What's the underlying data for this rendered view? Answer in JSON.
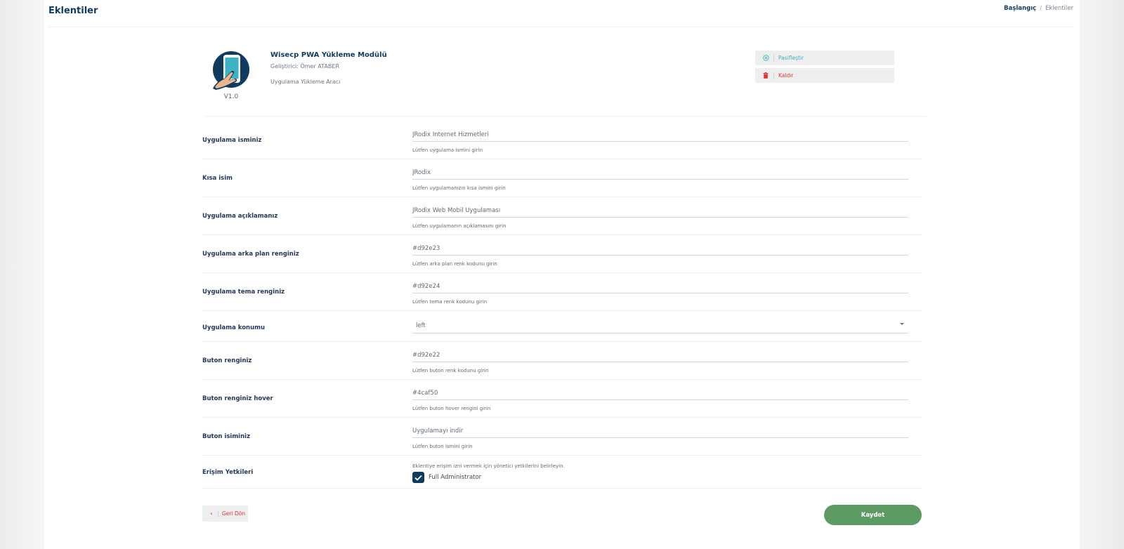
{
  "page": {
    "title": "Eklentiler"
  },
  "breadcrumb": {
    "home": "Başlangıç",
    "separator": "/",
    "current": "Eklentiler"
  },
  "plugin": {
    "name": "Wisecp PWA Yükleme Modülü",
    "developer": "Geliştirici: Ömer ATABER",
    "description": "Uygulama Yükleme Aracı",
    "version": "V1.0",
    "logo_icon": "phone-touch-icon"
  },
  "actions": {
    "deactivate": {
      "label": "Pasifleştir",
      "icon": "circle-x-icon",
      "color": "#3bb3c3"
    },
    "remove": {
      "label": "Kaldır",
      "icon": "trash-icon",
      "color": "#e0352f"
    }
  },
  "form": {
    "app_name": {
      "label": "Uygulama isminiz",
      "value": "JRodix Internet Hizmetleri",
      "help": "Lütfen uygulama ismini girin"
    },
    "short_name": {
      "label": "Kısa isim",
      "value": "JRodix",
      "help": "Lütfen uygulamanızın kısa ismini girin"
    },
    "app_description": {
      "label": "Uygulama açıklamanız",
      "value": "JRodix Web Mobil Uygulaması",
      "help": "Lütfen uygulamanın açıklamasını girin"
    },
    "bg_color": {
      "label": "Uygulama arka plan renginiz",
      "value": "#d92e23",
      "help": "Lütfen arka plan renk kodunu girin"
    },
    "theme_color": {
      "label": "Uygulama tema renginiz",
      "value": "#d92e24",
      "help": "Lütfen tema renk kodunu girin"
    },
    "position": {
      "label": "Uygulama konumu",
      "selected": "left"
    },
    "button_color": {
      "label": "Buton renginiz",
      "value": "#d92e22",
      "help": "Lütfen buton renk kodunu girin"
    },
    "button_hover": {
      "label": "Buton renginiz hover",
      "value": "#4caf50",
      "help": "Lütfen buton hover rengini girin"
    },
    "button_name": {
      "label": "Buton isiminiz",
      "value": "Uygulamayı indir",
      "help": "Lütfen buton ismini girin"
    },
    "permissions": {
      "label": "Erişim Yetkileri",
      "help": "Eklentiye erişim izni vermek için yönetici yetkilerini belirleyin.",
      "option": "Full Administrator",
      "checked": true
    }
  },
  "footer": {
    "back_label": "Geri Dön",
    "save_label": "Kaydet"
  },
  "colors": {
    "primary": "#0f3b5f",
    "accent_green": "#5d9a64",
    "danger": "#e0352f",
    "info": "#3bb3c3"
  }
}
